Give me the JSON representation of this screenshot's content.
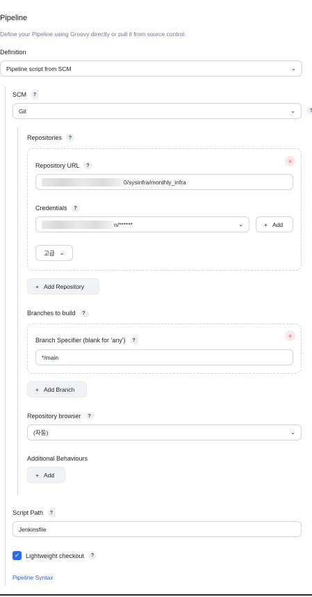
{
  "pipeline": {
    "title": "Pipeline",
    "description": "Define your Pipeline using Groovy directly or pull it from source control.",
    "definition_label": "Definition",
    "definition_value": "Pipeline script from SCM"
  },
  "scm": {
    "label": "SCM",
    "value": "Git"
  },
  "repositories": {
    "label": "Repositories",
    "url_label": "Repository URL",
    "url_value_visible": "0/sysinfra/monthly_infra",
    "credentials_label": "Credentials",
    "credentials_value_visible": "n/******",
    "add_credentials_label": "Add",
    "advanced_label": "고급",
    "add_repository_label": "Add Repository"
  },
  "branches": {
    "label": "Branches to build",
    "specifier_label": "Branch Specifier (blank for 'any')",
    "specifier_value": "*/main",
    "add_branch_label": "Add Branch"
  },
  "browser": {
    "label": "Repository browser",
    "value": "(자동)"
  },
  "behaviours": {
    "label": "Additional Behaviours",
    "add_label": "Add"
  },
  "script_path": {
    "label": "Script Path",
    "value": "Jenkinsfile"
  },
  "lightweight": {
    "label": "Lightweight checkout",
    "checked": true
  },
  "syntax_link": "Pipeline Syntax",
  "glyphs": {
    "help": "?",
    "chevron": "⌄",
    "close": "×",
    "plus": "+",
    "check": "✓"
  },
  "icons": [
    "help-icon",
    "chevron-down-icon",
    "close-icon",
    "plus-icon",
    "checkbox-check-icon"
  ],
  "colors": {
    "accent": "#2d6ce4",
    "link": "#2b5fc7",
    "remove": "#e05252"
  }
}
